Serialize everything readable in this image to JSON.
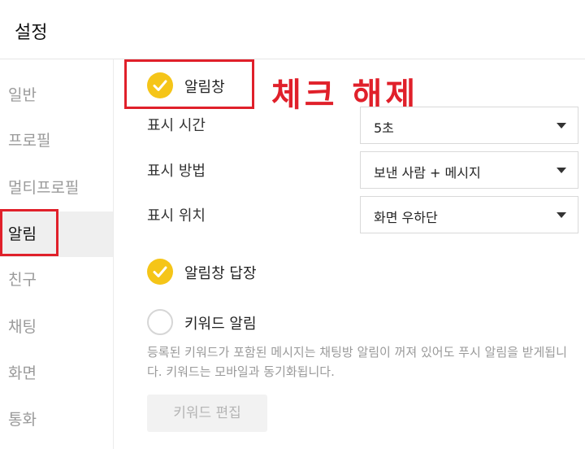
{
  "header": {
    "title": "설정"
  },
  "sidebar": {
    "items": [
      {
        "label": "일반"
      },
      {
        "label": "프로필"
      },
      {
        "label": "멀티프로필"
      },
      {
        "label": "알림"
      },
      {
        "label": "친구"
      },
      {
        "label": "채팅"
      },
      {
        "label": "화면"
      },
      {
        "label": "통화"
      }
    ],
    "active": "알림"
  },
  "notification": {
    "popup": {
      "label": "알림창",
      "checked": true
    },
    "rows": [
      {
        "label": "표시 시간",
        "value": "5초"
      },
      {
        "label": "표시 방법",
        "value": "보낸 사람 + 메시지"
      },
      {
        "label": "표시 위치",
        "value": "화면 우하단"
      }
    ],
    "reply": {
      "label": "알림창 답장",
      "checked": true
    },
    "keyword": {
      "label": "키워드 알림",
      "checked": false
    },
    "description": "등록된 키워드가 포함된 메시지는 채팅방 알림이 꺼져 있어도 푸시 알림을 받게됩니다. 키워드는 모바일과 동기화됩니다.",
    "edit_button": "키워드 편집"
  },
  "annotation": {
    "text": "체크 해제",
    "color": "#e0202a"
  },
  "colors": {
    "check_on": "#f5c518",
    "highlight": "#e0202a"
  }
}
